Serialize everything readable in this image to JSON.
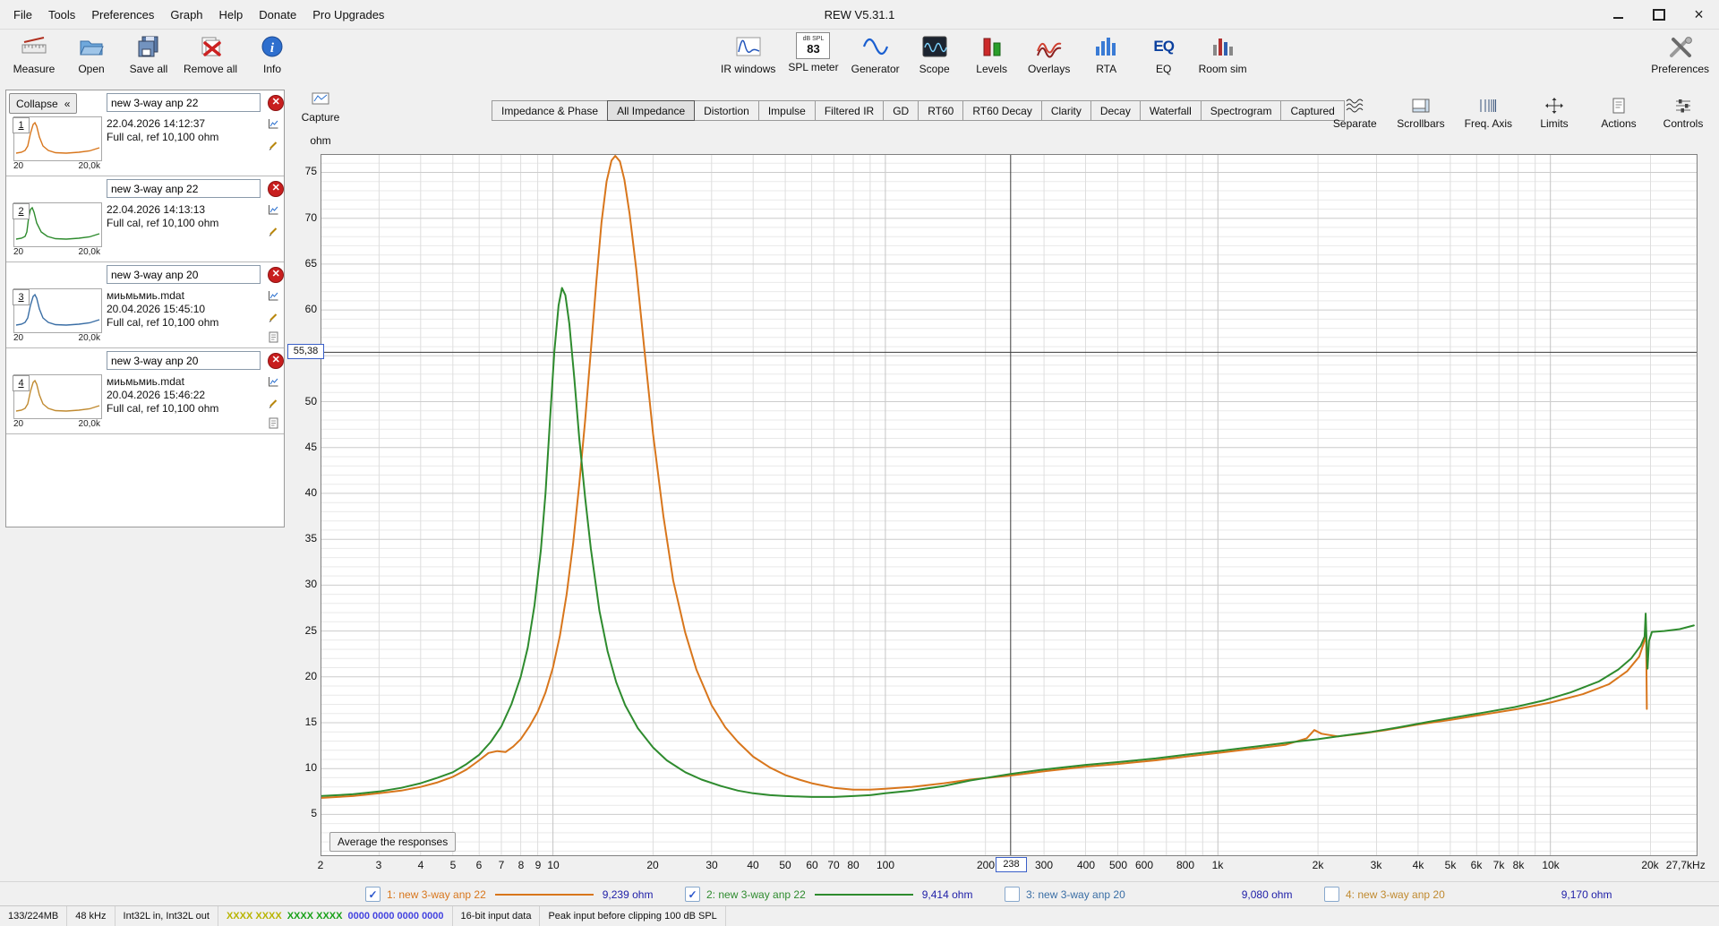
{
  "window": {
    "title": "REW V5.31.1"
  },
  "menu": {
    "items": [
      "File",
      "Tools",
      "Preferences",
      "Graph",
      "Help",
      "Donate",
      "Pro Upgrades"
    ]
  },
  "toolbar": {
    "left": [
      {
        "label": "Measure",
        "icon": "measure-icon"
      },
      {
        "label": "Open",
        "icon": "open-folder-icon"
      },
      {
        "label": "Save all",
        "icon": "save-all-icon"
      },
      {
        "label": "Remove all",
        "icon": "remove-all-icon"
      },
      {
        "label": "Info",
        "icon": "info-icon"
      }
    ],
    "center": [
      {
        "label": "IR windows",
        "icon": "ir-windows-icon"
      },
      {
        "label": "SPL meter",
        "icon": "spl-meter-icon"
      },
      {
        "label": "Generator",
        "icon": "generator-icon"
      },
      {
        "label": "Scope",
        "icon": "scope-icon"
      },
      {
        "label": "Levels",
        "icon": "levels-icon"
      },
      {
        "label": "Overlays",
        "icon": "overlays-icon"
      },
      {
        "label": "RTA",
        "icon": "rta-icon"
      },
      {
        "label": "EQ",
        "icon": "eq-icon"
      },
      {
        "label": "Room sim",
        "icon": "room-sim-icon"
      }
    ],
    "right": [
      {
        "label": "Preferences",
        "icon": "preferences-icon"
      }
    ],
    "spl_caption": "dB SPL",
    "spl_value": "83"
  },
  "sidebar": {
    "collapse_label": "Collapse",
    "collapse_icon": "«",
    "measurements": [
      {
        "num": "1",
        "name": "new 3-way anp 22",
        "datetime": "22.04.2026 14:12:37",
        "cal": "Full cal, ref 10,100 ohm",
        "range_min": "20",
        "range_max": "20,0k",
        "color": "#d8761c"
      },
      {
        "num": "2",
        "name": "new 3-way anp 22",
        "datetime": "22.04.2026 14:13:13",
        "cal": "Full cal, ref 10,100 ohm",
        "range_min": "20",
        "range_max": "20,0k",
        "color": "#2e8b2e"
      },
      {
        "num": "3",
        "name": "new 3-way anp 20",
        "file": "миьмьмиь.mdat",
        "datetime": "20.04.2026 15:45:10",
        "cal": "Full cal, ref 10,100 ohm",
        "range_min": "20",
        "range_max": "20,0k",
        "color": "#3a6ea5"
      },
      {
        "num": "4",
        "name": "new 3-way anp 20",
        "file": "миьмьмиь.mdat",
        "datetime": "20.04.2026 15:46:22",
        "cal": "Full cal, ref 10,100 ohm",
        "range_min": "20",
        "range_max": "20,0k",
        "color": "#c08a30"
      }
    ]
  },
  "graph": {
    "capture_label": "Capture",
    "unit_label": "ohm",
    "average_button": "Average the responses",
    "tabs": [
      "Impedance & Phase",
      "All Impedance",
      "Distortion",
      "Impulse",
      "Filtered IR",
      "GD",
      "RT60",
      "RT60 Decay",
      "Clarity",
      "Decay",
      "Waterfall",
      "Spectrogram",
      "Captured"
    ],
    "active_tab": "All Impedance",
    "controls": [
      "Separate",
      "Scrollbars",
      "Freq. Axis",
      "Limits",
      "Actions",
      "Controls"
    ]
  },
  "chart_data": {
    "type": "line",
    "title": "All Impedance",
    "xlabel": "Hz",
    "ylabel": "ohm",
    "x_scale": "log",
    "xlim": [
      2,
      27700
    ],
    "ylim": [
      0.45,
      77
    ],
    "grid": true,
    "x_end_label": "27,7kHz",
    "yticks": [
      5,
      10,
      15,
      20,
      25,
      30,
      35,
      40,
      45,
      50,
      55,
      60,
      65,
      70,
      75
    ],
    "xticks": [
      [
        2,
        "2"
      ],
      [
        3,
        "3"
      ],
      [
        4,
        "4"
      ],
      [
        5,
        "5"
      ],
      [
        6,
        "6"
      ],
      [
        7,
        "7"
      ],
      [
        8,
        "8"
      ],
      [
        9,
        "9"
      ],
      [
        10,
        "10"
      ],
      [
        20,
        "20"
      ],
      [
        30,
        "30"
      ],
      [
        40,
        "40"
      ],
      [
        50,
        "50"
      ],
      [
        60,
        "60"
      ],
      [
        70,
        "70"
      ],
      [
        80,
        "80"
      ],
      [
        100,
        "100"
      ],
      [
        200,
        "200"
      ],
      [
        300,
        "300"
      ],
      [
        400,
        "400"
      ],
      [
        500,
        "500"
      ],
      [
        600,
        "600"
      ],
      [
        800,
        "800"
      ],
      [
        1000,
        "1k"
      ],
      [
        2000,
        "2k"
      ],
      [
        3000,
        "3k"
      ],
      [
        4000,
        "4k"
      ],
      [
        5000,
        "5k"
      ],
      [
        6000,
        "6k"
      ],
      [
        7000,
        "7k"
      ],
      [
        8000,
        "8k"
      ],
      [
        10000,
        "10k"
      ],
      [
        20000,
        "20k"
      ]
    ],
    "cursor": {
      "freq": 238,
      "ohm": 55.38,
      "freq_label": "238",
      "ohm_label": "55,38"
    },
    "series": [
      {
        "name": "1: new 3-way anp 22",
        "color": "#d8761c",
        "points": [
          [
            2,
            6.8
          ],
          [
            2.5,
            7.0
          ],
          [
            3,
            7.3
          ],
          [
            3.5,
            7.6
          ],
          [
            4,
            8.0
          ],
          [
            4.5,
            8.5
          ],
          [
            5,
            9.1
          ],
          [
            5.5,
            9.9
          ],
          [
            6,
            10.9
          ],
          [
            6.4,
            11.7
          ],
          [
            6.8,
            11.9
          ],
          [
            7.2,
            11.8
          ],
          [
            7.6,
            12.4
          ],
          [
            8,
            13.2
          ],
          [
            8.5,
            14.6
          ],
          [
            9,
            16.2
          ],
          [
            9.5,
            18.3
          ],
          [
            10,
            21.0
          ],
          [
            10.5,
            24.5
          ],
          [
            11,
            29.0
          ],
          [
            11.5,
            34.5
          ],
          [
            12,
            41.0
          ],
          [
            12.5,
            48.0
          ],
          [
            13,
            55.5
          ],
          [
            13.5,
            63.0
          ],
          [
            14,
            69.5
          ],
          [
            14.5,
            74.0
          ],
          [
            15,
            76.3
          ],
          [
            15.4,
            76.8
          ],
          [
            15.9,
            76.2
          ],
          [
            16.4,
            74.2
          ],
          [
            17,
            70.5
          ],
          [
            17.8,
            64.5
          ],
          [
            18.8,
            56.0
          ],
          [
            20,
            46.5
          ],
          [
            21.5,
            37.5
          ],
          [
            23,
            30.5
          ],
          [
            25,
            24.8
          ],
          [
            27,
            20.8
          ],
          [
            30,
            16.9
          ],
          [
            33,
            14.5
          ],
          [
            36,
            12.9
          ],
          [
            40,
            11.3
          ],
          [
            45,
            10.1
          ],
          [
            50,
            9.3
          ],
          [
            55,
            8.8
          ],
          [
            60,
            8.4
          ],
          [
            70,
            7.9
          ],
          [
            80,
            7.7
          ],
          [
            90,
            7.7
          ],
          [
            100,
            7.8
          ],
          [
            120,
            8.0
          ],
          [
            150,
            8.4
          ],
          [
            180,
            8.8
          ],
          [
            238,
            9.24
          ],
          [
            300,
            9.7
          ],
          [
            400,
            10.2
          ],
          [
            500,
            10.5
          ],
          [
            650,
            10.9
          ],
          [
            800,
            11.3
          ],
          [
            1000,
            11.7
          ],
          [
            1300,
            12.2
          ],
          [
            1600,
            12.6
          ],
          [
            1850,
            13.3
          ],
          [
            1950,
            14.2
          ],
          [
            2050,
            13.8
          ],
          [
            2300,
            13.5
          ],
          [
            2700,
            13.8
          ],
          [
            3200,
            14.2
          ],
          [
            4000,
            14.8
          ],
          [
            5000,
            15.3
          ],
          [
            6300,
            15.9
          ],
          [
            8000,
            16.5
          ],
          [
            10000,
            17.2
          ],
          [
            12500,
            18.1
          ],
          [
            15000,
            19.2
          ],
          [
            17000,
            20.6
          ],
          [
            18500,
            22.2
          ],
          [
            19300,
            24.2
          ],
          [
            19400,
            24.6
          ],
          [
            19500,
            16.5
          ]
        ]
      },
      {
        "name": "2: new 3-way anp 22",
        "color": "#2e8b2e",
        "points": [
          [
            2,
            7.0
          ],
          [
            2.5,
            7.2
          ],
          [
            3,
            7.5
          ],
          [
            3.5,
            7.9
          ],
          [
            4,
            8.4
          ],
          [
            4.5,
            9.0
          ],
          [
            5,
            9.6
          ],
          [
            5.5,
            10.5
          ],
          [
            6,
            11.5
          ],
          [
            6.5,
            12.9
          ],
          [
            7,
            14.6
          ],
          [
            7.5,
            17.0
          ],
          [
            8,
            20.0
          ],
          [
            8.4,
            23.2
          ],
          [
            8.8,
            27.8
          ],
          [
            9.2,
            33.8
          ],
          [
            9.5,
            40.0
          ],
          [
            9.8,
            48.0
          ],
          [
            10.1,
            55.5
          ],
          [
            10.4,
            60.5
          ],
          [
            10.65,
            62.4
          ],
          [
            10.9,
            61.6
          ],
          [
            11.2,
            58.5
          ],
          [
            11.6,
            52.5
          ],
          [
            12,
            46.0
          ],
          [
            12.5,
            39.5
          ],
          [
            13,
            34.0
          ],
          [
            13.8,
            27.2
          ],
          [
            14.6,
            22.8
          ],
          [
            15.5,
            19.4
          ],
          [
            16.5,
            16.9
          ],
          [
            18,
            14.4
          ],
          [
            20,
            12.3
          ],
          [
            22,
            10.9
          ],
          [
            25,
            9.6
          ],
          [
            28,
            8.8
          ],
          [
            32,
            8.1
          ],
          [
            36,
            7.6
          ],
          [
            40,
            7.3
          ],
          [
            45,
            7.1
          ],
          [
            50,
            7.0
          ],
          [
            60,
            6.9
          ],
          [
            70,
            6.9
          ],
          [
            80,
            7.0
          ],
          [
            90,
            7.1
          ],
          [
            100,
            7.3
          ],
          [
            120,
            7.6
          ],
          [
            150,
            8.1
          ],
          [
            180,
            8.7
          ],
          [
            238,
            9.41
          ],
          [
            300,
            9.9
          ],
          [
            400,
            10.4
          ],
          [
            500,
            10.7
          ],
          [
            650,
            11.1
          ],
          [
            800,
            11.5
          ],
          [
            1000,
            11.9
          ],
          [
            1300,
            12.4
          ],
          [
            1600,
            12.8
          ],
          [
            2000,
            13.2
          ],
          [
            2400,
            13.6
          ],
          [
            2900,
            14.0
          ],
          [
            3500,
            14.5
          ],
          [
            4300,
            15.1
          ],
          [
            5200,
            15.6
          ],
          [
            6300,
            16.1
          ],
          [
            7800,
            16.7
          ],
          [
            9500,
            17.4
          ],
          [
            11500,
            18.3
          ],
          [
            14000,
            19.5
          ],
          [
            16000,
            20.8
          ],
          [
            17500,
            22.0
          ],
          [
            18700,
            23.4
          ],
          [
            19200,
            24.4
          ],
          [
            19350,
            26.9
          ],
          [
            19500,
            23.0
          ],
          [
            19600,
            20.9
          ],
          [
            19800,
            23.9
          ],
          [
            20200,
            24.9
          ],
          [
            22000,
            25.0
          ],
          [
            24500,
            25.2
          ],
          [
            27000,
            25.6
          ]
        ]
      }
    ]
  },
  "legend": {
    "items": [
      {
        "check": "✓",
        "checked": true,
        "label": "1: new 3-way anp 22",
        "value": "9,239 ohm",
        "color": "#d8761c",
        "show_line": true
      },
      {
        "check": "✓",
        "checked": true,
        "label": "2: new 3-way anp 22",
        "value": "9,414 ohm",
        "color": "#2e8b2e",
        "show_line": true
      },
      {
        "check": "",
        "checked": false,
        "label": "3: new 3-way anp 20",
        "value": "9,080 ohm",
        "color": "#3a6ea5",
        "show_line": false
      },
      {
        "check": "",
        "checked": false,
        "label": "4: new 3-way anp 20",
        "value": "9,170 ohm",
        "color": "#c08a30",
        "show_line": false
      }
    ]
  },
  "statusbar": {
    "memory": "133/224MB",
    "sample_rate": "48 kHz",
    "io": "Int32L in, Int32L out",
    "ch_a": "XXXX XXXX",
    "ch_b": "XXXX XXXX",
    "zeros": "0000 0000  0000 0000",
    "input": "16-bit input data",
    "peak": "Peak input before clipping 100 dB SPL"
  }
}
